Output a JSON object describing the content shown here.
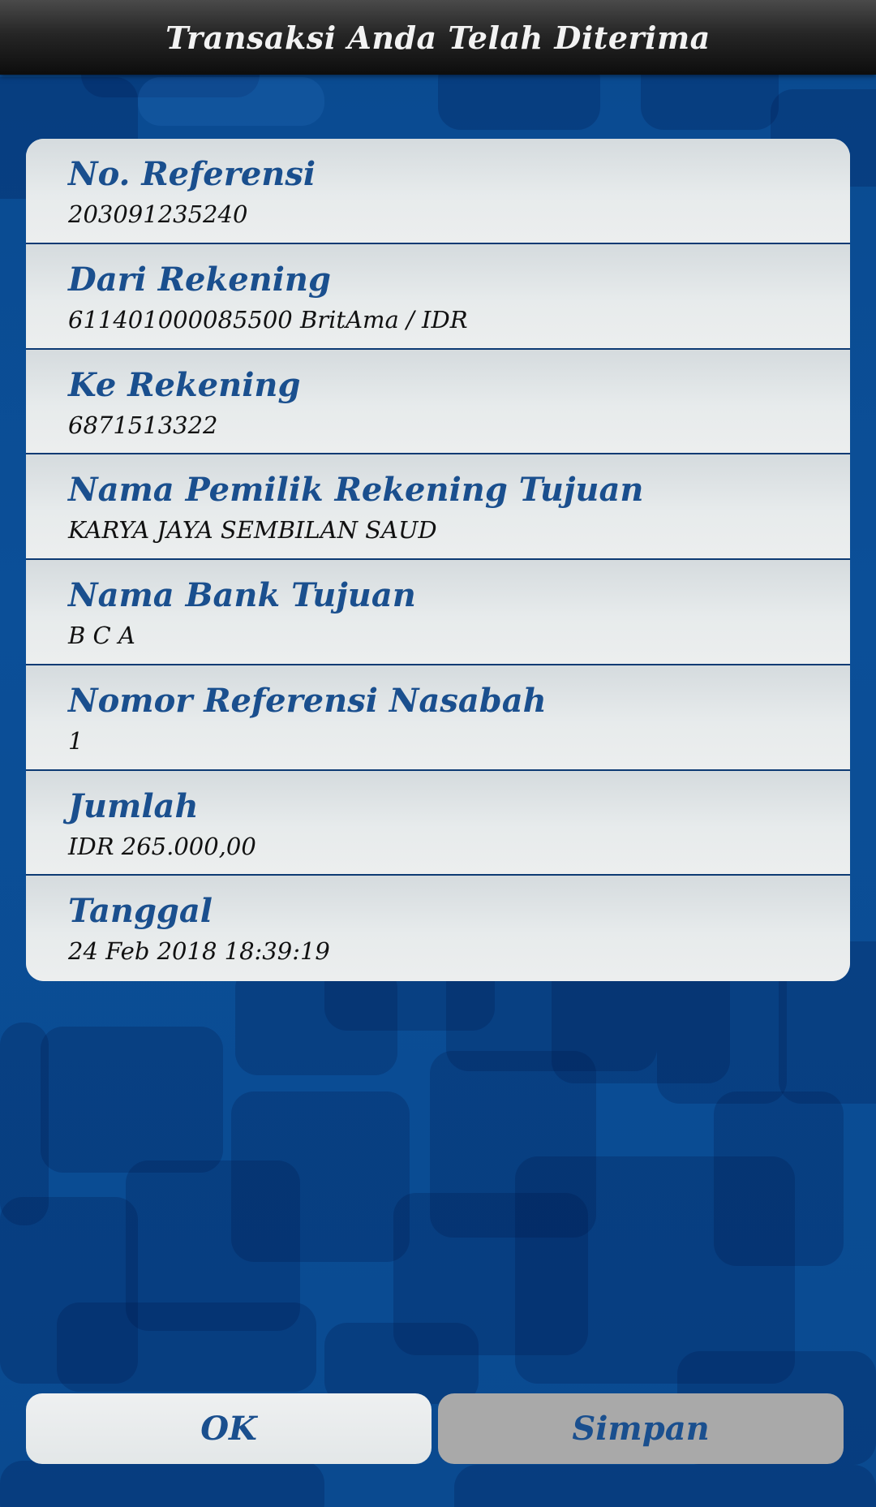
{
  "header": {
    "title": "Transaksi Anda Telah Diterima"
  },
  "details": [
    {
      "label": "No. Referensi",
      "value": "203091235240"
    },
    {
      "label": "Dari Rekening",
      "value": "611401000085500  BritAma / IDR"
    },
    {
      "label": "Ke Rekening",
      "value": "6871513322"
    },
    {
      "label": "Nama Pemilik Rekening Tujuan",
      "value": "KARYA JAYA SEMBILAN SAUD"
    },
    {
      "label": "Nama Bank Tujuan",
      "value": "B C A"
    },
    {
      "label": "Nomor Referensi Nasabah",
      "value": "1"
    },
    {
      "label": "Jumlah",
      "value": "IDR 265.000,00"
    },
    {
      "label": "Tanggal",
      "value": "24 Feb 2018 18:39:19"
    }
  ],
  "actions": {
    "ok_label": "OK",
    "save_label": "Simpan"
  },
  "colors": {
    "background": "#0a4d94",
    "header": "#1a1a1a",
    "label": "#1a4f8e",
    "divider": "#0d3a73",
    "save_button": "#a9a9a9"
  }
}
